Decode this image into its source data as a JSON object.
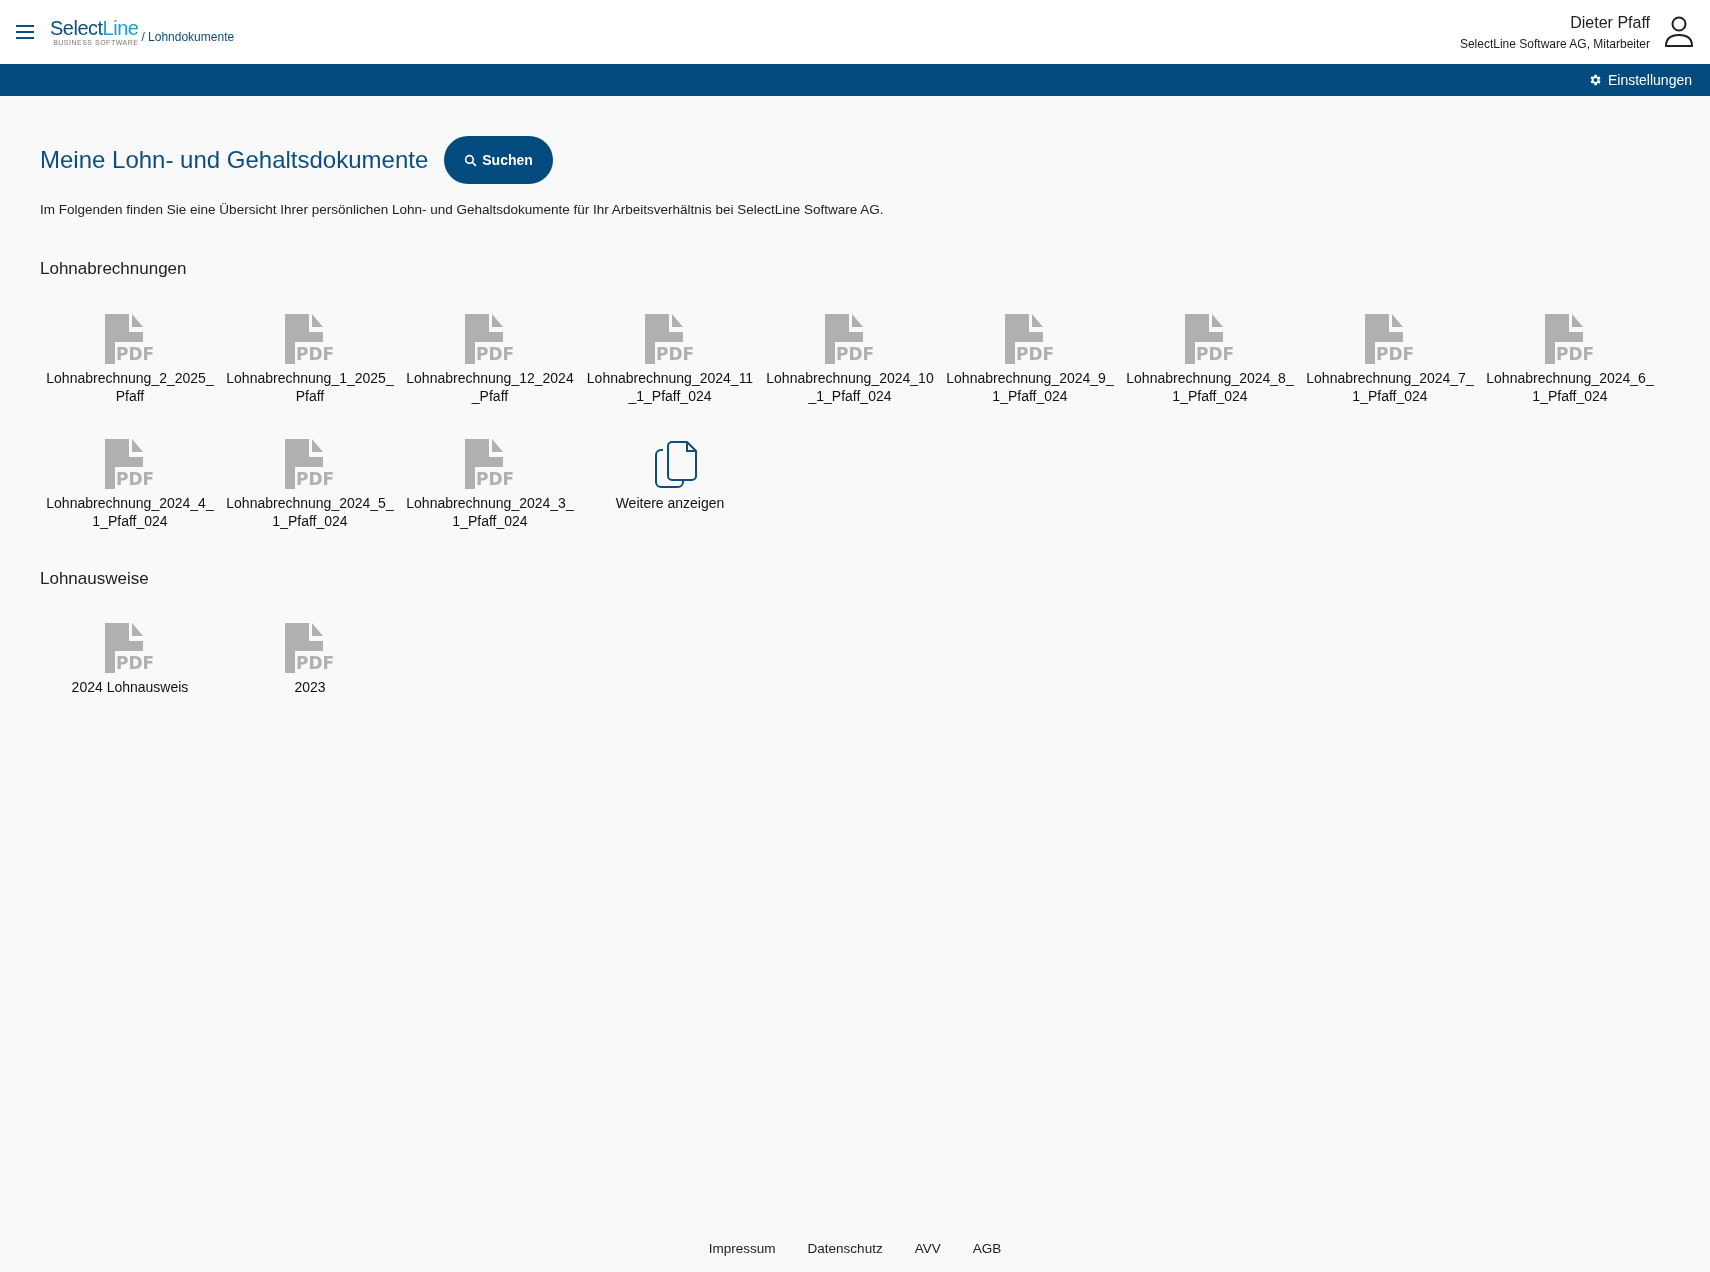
{
  "header": {
    "logo": {
      "part1": "Select",
      "part2": "Line",
      "tagline": "BUSINESS SOFTWARE"
    },
    "breadcrumb": "/ Lohndokumente",
    "user": {
      "name": "Dieter Pfaff",
      "role": "SelectLine Software AG, Mitarbeiter"
    }
  },
  "toolbar": {
    "settings": "Einstellungen"
  },
  "page": {
    "title": "Meine Lohn- und Gehaltsdokumente",
    "search_button": "Suchen",
    "intro": "Im Folgenden finden Sie eine Übersicht Ihrer persönlichen Lohn- und Gehaltsdokumente für Ihr Arbeitsverhältnis bei SelectLine Software AG."
  },
  "sections": [
    {
      "title": "Lohnabrechnungen",
      "items": [
        {
          "kind": "pdf",
          "badge": "PDF",
          "name": "Lohnabrechnung_2_2025_Pfaff"
        },
        {
          "kind": "pdf",
          "badge": "PDF",
          "name": "Lohnabrechnung_1_2025_Pfaff"
        },
        {
          "kind": "pdf",
          "badge": "PDF",
          "name": "Lohnabrechnung_12_2024_Pfaff"
        },
        {
          "kind": "pdf",
          "badge": "PDF",
          "name": "Lohnabrechnung_2024_11_1_Pfaff_024"
        },
        {
          "kind": "pdf",
          "badge": "PDF",
          "name": "Lohnabrechnung_2024_10_1_Pfaff_024"
        },
        {
          "kind": "pdf",
          "badge": "PDF",
          "name": "Lohnabrechnung_2024_9_1_Pfaff_024"
        },
        {
          "kind": "pdf",
          "badge": "PDF",
          "name": "Lohnabrechnung_2024_8_1_Pfaff_024"
        },
        {
          "kind": "pdf",
          "badge": "PDF",
          "name": "Lohnabrechnung_2024_7_1_Pfaff_024"
        },
        {
          "kind": "pdf",
          "badge": "PDF",
          "name": "Lohnabrechnung_2024_6_1_Pfaff_024"
        },
        {
          "kind": "pdf",
          "badge": "PDF",
          "name": "Lohnabrechnung_2024_4_1_Pfaff_024"
        },
        {
          "kind": "pdf",
          "badge": "PDF",
          "name": "Lohnabrechnung_2024_5_1_Pfaff_024"
        },
        {
          "kind": "pdf",
          "badge": "PDF",
          "name": "Lohnabrechnung_2024_3_1_Pfaff_024"
        },
        {
          "kind": "more",
          "name": "Weitere anzeigen"
        }
      ]
    },
    {
      "title": "Lohnausweise",
      "items": [
        {
          "kind": "pdf",
          "badge": "PDF",
          "name": "2024 Lohnausweis"
        },
        {
          "kind": "pdf",
          "badge": "PDF",
          "name": "2023"
        }
      ]
    }
  ],
  "footer": [
    "Impressum",
    "Datenschutz",
    "AVV",
    "AGB"
  ]
}
